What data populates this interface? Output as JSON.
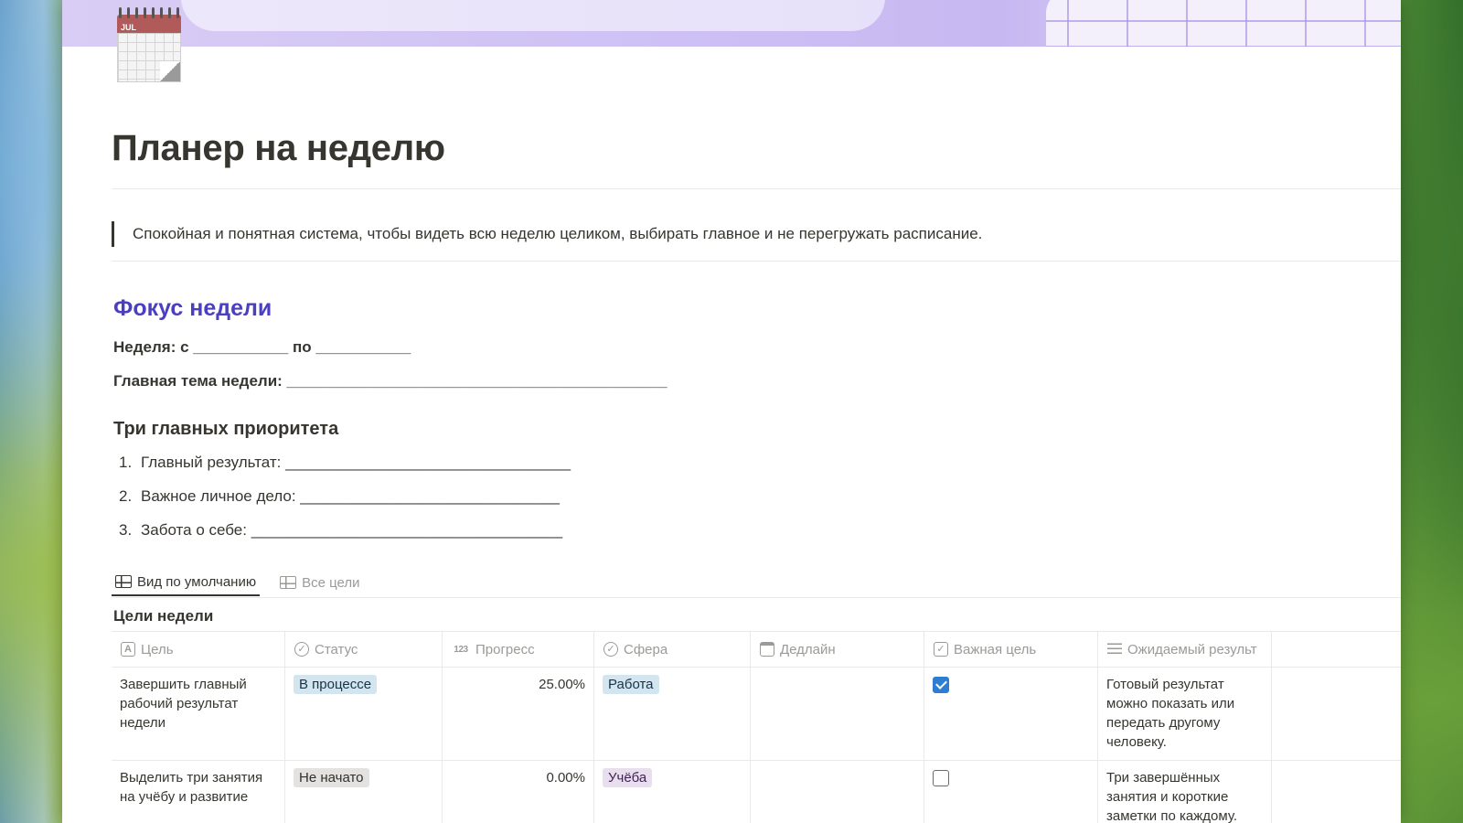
{
  "page": {
    "title": "Планер на неделю",
    "quote": "Спокойная и понятная система, чтобы видеть всю неделю целиком, выбирать главное и не перегружать расписание.",
    "icon": "calendar-icon",
    "icon_label": "JUL"
  },
  "focus": {
    "heading": "Фокус недели",
    "week_line": "Неделя: с ___________ по ___________",
    "theme_line": "Главная тема недели: ____________________________________________",
    "heading_color": "#4b3fc1"
  },
  "priorities": {
    "heading": "Три главных приоритета",
    "items": [
      {
        "num": "1.",
        "text": "Главный результат: _________________________________"
      },
      {
        "num": "2.",
        "text": "Важное личное дело: ______________________________"
      },
      {
        "num": "3.",
        "text": "Забота о себе: ____________________________________"
      }
    ]
  },
  "tabs": [
    {
      "label": "Вид по умолчанию",
      "icon": "table-icon",
      "active": true
    },
    {
      "label": "Все цели",
      "icon": "table-icon",
      "active": false
    }
  ],
  "database": {
    "title": "Цели недели",
    "columns": [
      {
        "label": "Цель",
        "icon": "text-property-icon"
      },
      {
        "label": "Статус",
        "icon": "status-property-icon"
      },
      {
        "label": "Прогресс",
        "icon": "number-property-icon",
        "icon_text": "123"
      },
      {
        "label": "Сфера",
        "icon": "select-property-icon"
      },
      {
        "label": "Дедлайн",
        "icon": "date-property-icon"
      },
      {
        "label": "Важная цель",
        "icon": "checkbox-property-icon"
      },
      {
        "label": "Ожидаемый результ",
        "icon": "text-lines-property-icon"
      }
    ],
    "rows": [
      {
        "goal": "Завершить главный рабочий результат недели",
        "status": "В процессе",
        "progress": "25.00%",
        "area": "Работа",
        "deadline": "",
        "important": true,
        "result": "Готовый результат можно показать или передать другому человеку."
      },
      {
        "goal": "Выделить три занятия на учёбу и развитие",
        "status": "Не начато",
        "progress": "0.00%",
        "area": "Учёба",
        "deadline": "",
        "important": false,
        "result": "Три завершённых занятия и короткие заметки по каждому."
      }
    ]
  },
  "colors": {
    "status_in_progress": "#d3e5ef",
    "status_not_started": "#e3e2e0",
    "area_work": "#d3e5ef",
    "area_study": "#e8deee",
    "checkbox_checked": "#2f7dd1"
  }
}
